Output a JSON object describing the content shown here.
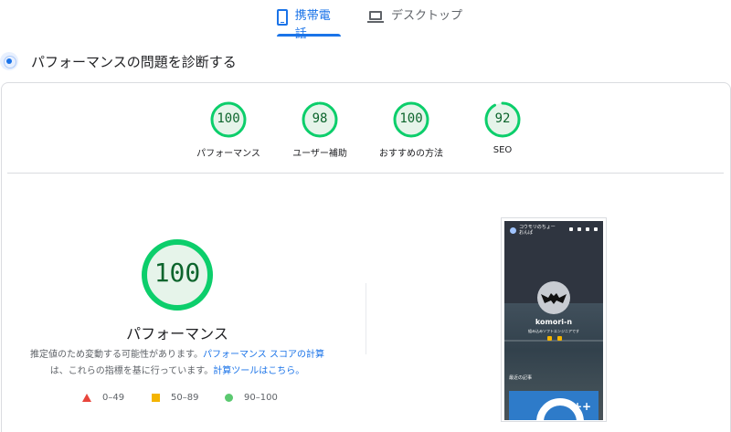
{
  "tabs": {
    "mobile_label": "携帯電話",
    "desktop_label": "デスクトップ"
  },
  "section": {
    "title": "パフォーマンスの問題を診断する"
  },
  "gauges": [
    {
      "score": "100",
      "value": 100,
      "label": "パフォーマンス"
    },
    {
      "score": "98",
      "value": 98,
      "label": "ユーザー補助"
    },
    {
      "score": "100",
      "value": 100,
      "label": "おすすめの方法"
    },
    {
      "score": "92",
      "value": 92,
      "label": "SEO"
    }
  ],
  "detail": {
    "score": "100",
    "value": 100,
    "label": "パフォーマンス",
    "desc_text1": "推定値のため変動する可能性があります。",
    "desc_link1": "パフォーマンス スコアの計算",
    "desc_text2": "は、これらの指標を基に行っています。",
    "desc_link2": "計算ツールはこちら。"
  },
  "legend": {
    "fail": "0–49",
    "average": "50–89",
    "pass": "90–100"
  },
  "screenshot": {
    "site_title": "コウモリのちょーおんぱ",
    "name": "komori-n",
    "subtitle": "組み込みソフトエンジニアです",
    "recent": "最近の記事",
    "thumb_text": "++"
  },
  "colors": {
    "accent": "#1a73e8",
    "pass": "#0cce6b",
    "pass_text": "#0d652d",
    "average": "#f4b400",
    "fail": "#e8453c"
  }
}
